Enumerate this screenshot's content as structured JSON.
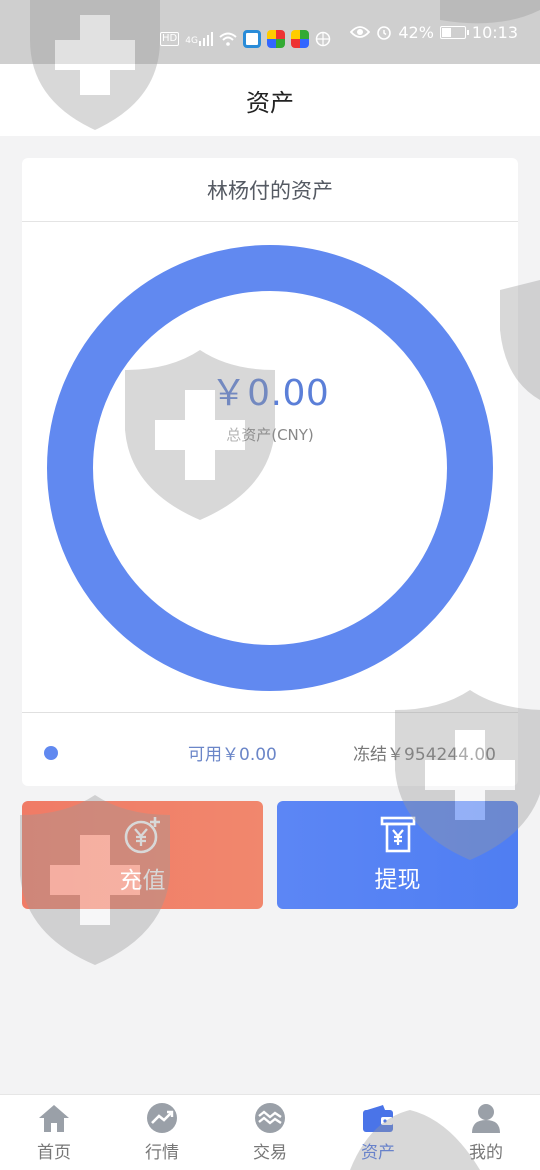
{
  "status_bar": {
    "network_label": "HD",
    "signal_label": "4G",
    "battery_percent": "42%",
    "battery_level": 0.42,
    "time": "10:13"
  },
  "header": {
    "title": "资产"
  },
  "card": {
    "title": "林杨付的资产",
    "total_value": "￥0.00",
    "total_label": "总资产(CNY)",
    "available": "可用￥0.00",
    "frozen": "冻结￥954244.00",
    "ring_color": "#6189f0"
  },
  "actions": {
    "recharge_label": "充值",
    "withdraw_label": "提现"
  },
  "nav": {
    "items": [
      {
        "label": "首页",
        "icon": "home-icon"
      },
      {
        "label": "行情",
        "icon": "market-trend-icon"
      },
      {
        "label": "交易",
        "icon": "trade-icon"
      },
      {
        "label": "资产",
        "icon": "wallet-icon",
        "active": true
      },
      {
        "label": "我的",
        "icon": "user-icon"
      }
    ]
  }
}
